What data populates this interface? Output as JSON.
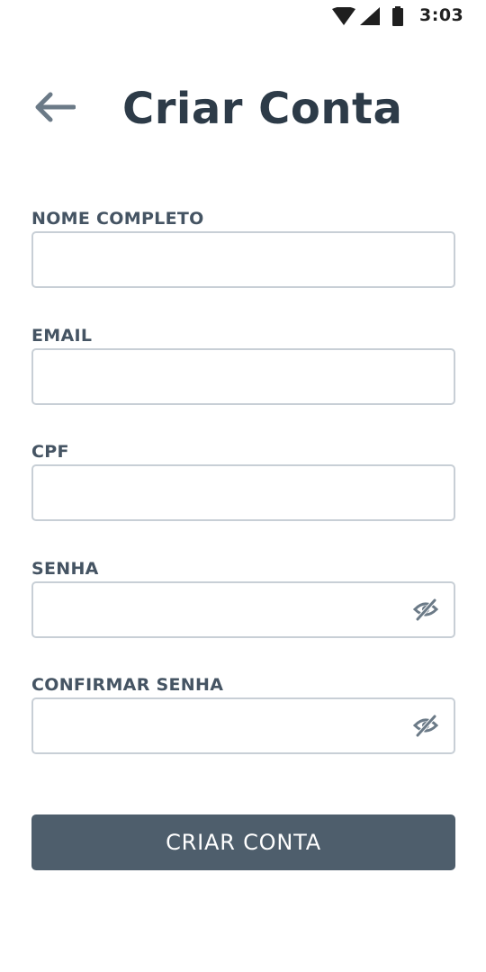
{
  "status_bar": {
    "time": "3:03",
    "icons": [
      "wifi-icon",
      "cellular-signal-icon",
      "battery-icon"
    ]
  },
  "header": {
    "back_icon": "arrow-left-icon",
    "title": "Criar Conta"
  },
  "form": {
    "fields": [
      {
        "label": "NOME COMPLETO",
        "value": "",
        "type": "text"
      },
      {
        "label": "EMAIL",
        "value": "",
        "type": "email"
      },
      {
        "label": "CPF",
        "value": "",
        "type": "text"
      },
      {
        "label": "SENHA",
        "value": "",
        "type": "password",
        "toggle_icon": "eye-off-icon"
      },
      {
        "label": "CONFIRMAR SENHA",
        "value": "",
        "type": "password",
        "toggle_icon": "eye-off-icon"
      }
    ],
    "submit_label": "CRIAR CONTA"
  },
  "colors": {
    "title": "#2d3b48",
    "label": "#455463",
    "input_border": "#c8cfd6",
    "button_bg": "#4e5e6c",
    "back_arrow": "#6b7a87",
    "eye_icon": "#6b7a87"
  }
}
